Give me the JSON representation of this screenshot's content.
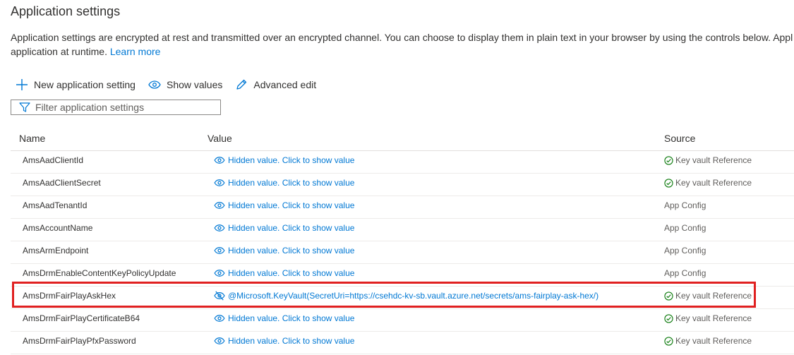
{
  "page": {
    "title": "Application settings",
    "description_line1": "Application settings are encrypted at rest and transmitted over an encrypted channel. You can choose to display them in plain text in your browser by using the controls below. Appl",
    "description_line2": "application at runtime.",
    "learn_more": "Learn more"
  },
  "toolbar": {
    "new_setting": "New application setting",
    "show_values": "Show values",
    "advanced_edit": "Advanced edit"
  },
  "filter": {
    "placeholder": "Filter application settings"
  },
  "table": {
    "headers": {
      "name": "Name",
      "value": "Value",
      "source": "Source"
    },
    "rows": [
      {
        "name": "AmsAadClientId",
        "value": "Hidden value. Click to show value",
        "source": "Key vault Reference",
        "source_ok": true,
        "revealed": false
      },
      {
        "name": "AmsAadClientSecret",
        "value": "Hidden value. Click to show value",
        "source": "Key vault Reference",
        "source_ok": true,
        "revealed": false
      },
      {
        "name": "AmsAadTenantId",
        "value": "Hidden value. Click to show value",
        "source": "App Config",
        "source_ok": false,
        "revealed": false
      },
      {
        "name": "AmsAccountName",
        "value": "Hidden value. Click to show value",
        "source": "App Config",
        "source_ok": false,
        "revealed": false
      },
      {
        "name": "AmsArmEndpoint",
        "value": "Hidden value. Click to show value",
        "source": "App Config",
        "source_ok": false,
        "revealed": false
      },
      {
        "name": "AmsDrmEnableContentKeyPolicyUpdate",
        "value": "Hidden value. Click to show value",
        "source": "App Config",
        "source_ok": false,
        "revealed": false
      },
      {
        "name": "AmsDrmFairPlayAskHex",
        "value": "@Microsoft.KeyVault(SecretUri=https://csehdc-kv-sb.vault.azure.net/secrets/ams-fairplay-ask-hex/)",
        "source": "Key vault Reference",
        "source_ok": true,
        "revealed": true
      },
      {
        "name": "AmsDrmFairPlayCertificateB64",
        "value": "Hidden value. Click to show value",
        "source": "Key vault Reference",
        "source_ok": true,
        "revealed": false
      },
      {
        "name": "AmsDrmFairPlayPfxPassword",
        "value": "Hidden value. Click to show value",
        "source": "Key vault Reference",
        "source_ok": true,
        "revealed": false
      }
    ]
  },
  "colors": {
    "link": "#0078d4",
    "success": "#107c10",
    "highlight": "#e02020"
  },
  "icons": {
    "new": "plus-icon",
    "show": "eye-icon",
    "edit": "pencil-icon",
    "filter": "filter-icon",
    "hidden": "eye-icon",
    "revealed": "eye-hide-icon",
    "ok": "check-circle-icon"
  }
}
